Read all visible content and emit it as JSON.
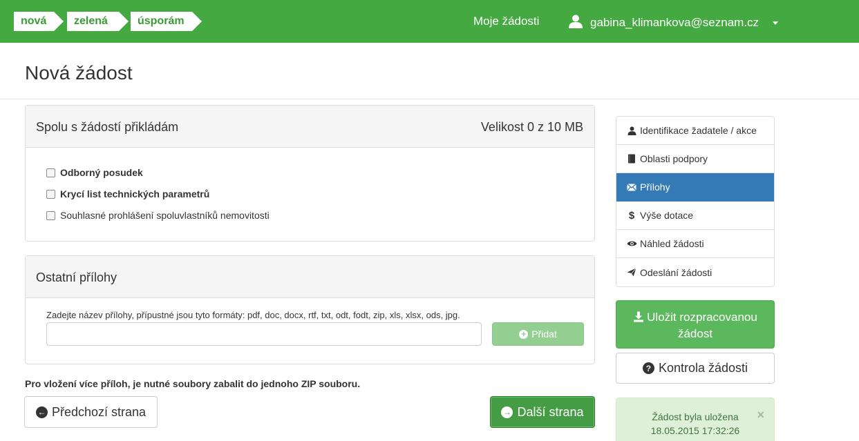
{
  "header": {
    "logo": [
      "nová",
      "zelená",
      "úsporám"
    ],
    "nav_requests": "Moje žádosti",
    "user_email": "gabina_klimankova@seznam.cz",
    "bg_color": "#44a940"
  },
  "page": {
    "title": "Nová žádost"
  },
  "attachments_panel": {
    "title": "Spolu s žádostí přikládám",
    "size_text": "Velikost 0 z 10 MB",
    "items": [
      {
        "label": "Odborný posudek",
        "checked": false,
        "bold": true
      },
      {
        "label": "Krycí list technických parametrů",
        "checked": false,
        "bold": true
      },
      {
        "label": "Souhlasné prohlášení spoluvlastníků nemovitosti",
        "checked": false,
        "bold": false
      }
    ]
  },
  "other_panel": {
    "title": "Ostatní přílohy",
    "hint": "Zadejte název přílohy, přípustné jsou tyto formáty: pdf, doc, docx, rtf, txt, odt, fodt, zip, xls, xlsx, ods, jpg.",
    "input_value": "",
    "add_label": "Přidat"
  },
  "zip_note": "Pro vložení více příloh, je nutné soubory zabalit do jednoho ZIP souboru.",
  "buttons": {
    "prev": "Předchozí strana",
    "next": "Další strana",
    "save_line1": "Uložit rozpracovanou",
    "save_line2": "žádost",
    "check": "Kontrola žádosti"
  },
  "sidebar": {
    "items": [
      {
        "label": "Identifikace žadatele / akce",
        "icon": "user-icon",
        "active": false
      },
      {
        "label": "Oblasti podpory",
        "icon": "book-icon",
        "active": false
      },
      {
        "label": "Přílohy",
        "icon": "envelope-icon",
        "active": true
      },
      {
        "label": "Výše dotace",
        "icon": "dollar-icon",
        "active": false
      },
      {
        "label": "Náhled žádosti",
        "icon": "eye-icon",
        "active": false
      },
      {
        "label": "Odeslání žádosti",
        "icon": "send-icon",
        "active": false
      }
    ]
  },
  "alert": {
    "line1": "Žádost byla uložena",
    "line2": "18.05.2015 17:32:26",
    "close": "×"
  }
}
